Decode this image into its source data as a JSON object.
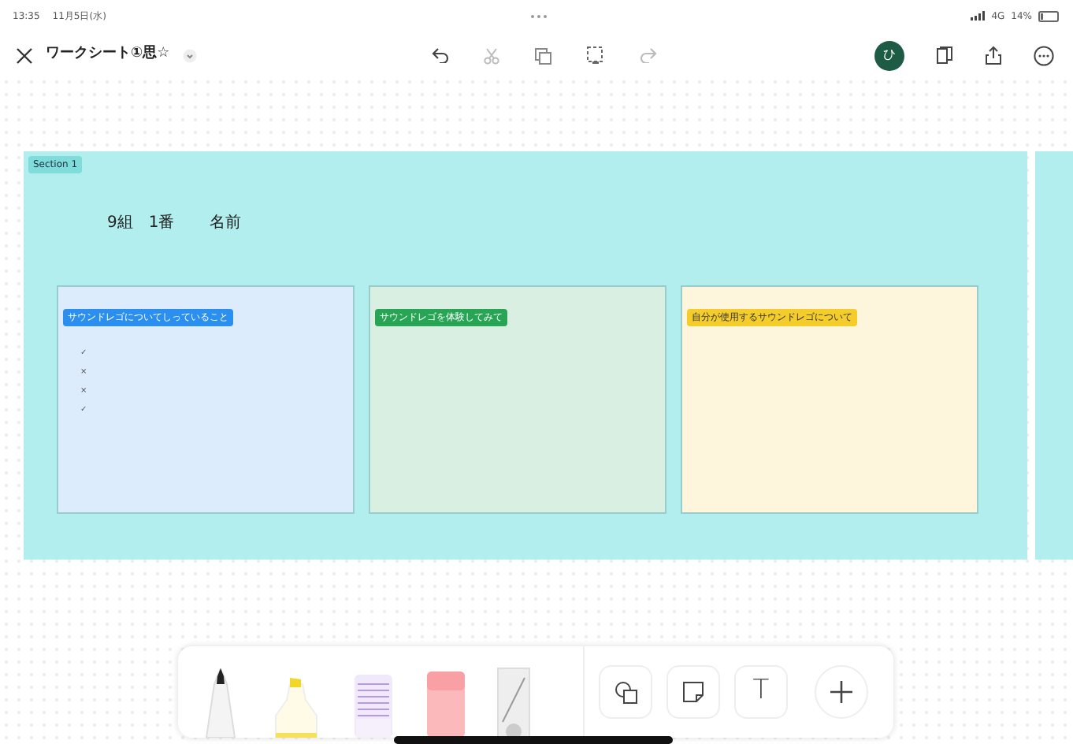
{
  "status_bar": {
    "time": "13:35",
    "date": "11月5日(水)",
    "network": "4G",
    "battery": "14%"
  },
  "toolbar": {
    "title": "ワークシート①思☆",
    "avatar": "ひ"
  },
  "section": {
    "label": "Section 1",
    "heading": [
      "9組",
      "1番",
      "名前"
    ],
    "cards": [
      {
        "tag": "サウンドレゴについてしっていること",
        "color": "#2b8ff0",
        "marks": [
          "✓",
          "×",
          "×",
          "✓"
        ]
      },
      {
        "tag": "サウンドレゴを体験してみて",
        "color": "#27a554"
      },
      {
        "tag": "自分が使用するサウンドレゴについて",
        "color": "#f4cd2a"
      }
    ]
  },
  "tools": [
    {
      "kind": "pen"
    },
    {
      "kind": "highlighter"
    },
    {
      "kind": "lasso"
    },
    {
      "kind": "eraser"
    },
    {
      "kind": "ruler"
    }
  ],
  "actions": [
    {
      "kind": "shapes"
    },
    {
      "kind": "sticky"
    },
    {
      "kind": "text",
      "label": "T"
    },
    {
      "kind": "add"
    }
  ]
}
